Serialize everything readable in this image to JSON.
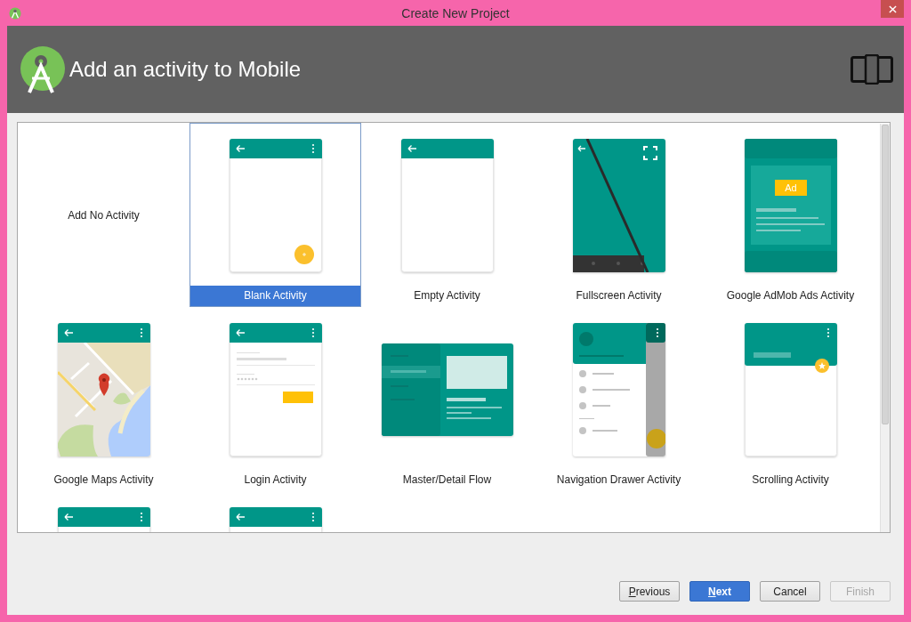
{
  "window": {
    "title": "Create New Project"
  },
  "header": {
    "title": "Add an activity to Mobile"
  },
  "tiles": [
    {
      "kind": "none",
      "label": "Add No Activity",
      "selected": false
    },
    {
      "kind": "blank",
      "label": "Blank Activity",
      "selected": true
    },
    {
      "kind": "empty",
      "label": "Empty Activity",
      "selected": false
    },
    {
      "kind": "fullscreen",
      "label": "Fullscreen Activity",
      "selected": false
    },
    {
      "kind": "admob",
      "label": "Google AdMob Ads Activity",
      "selected": false,
      "badge": "Ad"
    },
    {
      "kind": "maps",
      "label": "Google Maps Activity",
      "selected": false
    },
    {
      "kind": "login",
      "label": "Login Activity",
      "selected": false
    },
    {
      "kind": "masterdetail",
      "label": "Master/Detail Flow",
      "selected": false
    },
    {
      "kind": "navdrawer",
      "label": "Navigation Drawer Activity",
      "selected": false
    },
    {
      "kind": "scrolling",
      "label": "Scrolling Activity",
      "selected": false
    },
    {
      "kind": "partial",
      "selected": false
    },
    {
      "kind": "partial",
      "selected": false
    }
  ],
  "buttons": [
    {
      "label": "Previous",
      "mnemonic": true,
      "primary": false,
      "disabled": false
    },
    {
      "label": "Next",
      "mnemonic": true,
      "primary": true,
      "disabled": false
    },
    {
      "label": "Cancel",
      "mnemonic": false,
      "primary": false,
      "disabled": false
    },
    {
      "label": "Finish",
      "mnemonic": false,
      "primary": false,
      "disabled": true
    }
  ]
}
